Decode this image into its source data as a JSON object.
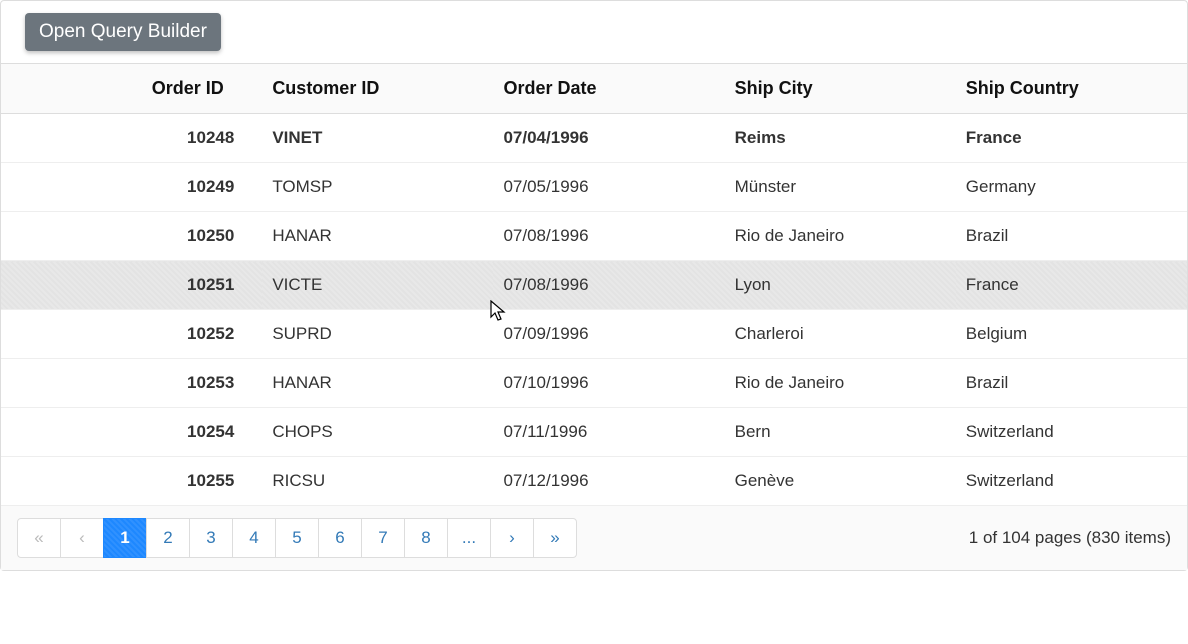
{
  "toolbar": {
    "open_qb_label": "Open Query Builder"
  },
  "columns": {
    "order_id": "Order ID",
    "customer_id": "Customer ID",
    "order_date": "Order Date",
    "ship_city": "Ship City",
    "ship_country": "Ship Country"
  },
  "rows": [
    {
      "order_id": "10248",
      "customer_id": "VINET",
      "order_date": "07/04/1996",
      "ship_city": "Reims",
      "ship_country": "France",
      "selected": true
    },
    {
      "order_id": "10249",
      "customer_id": "TOMSP",
      "order_date": "07/05/1996",
      "ship_city": "Münster",
      "ship_country": "Germany"
    },
    {
      "order_id": "10250",
      "customer_id": "HANAR",
      "order_date": "07/08/1996",
      "ship_city": "Rio de Janeiro",
      "ship_country": "Brazil"
    },
    {
      "order_id": "10251",
      "customer_id": "VICTE",
      "order_date": "07/08/1996",
      "ship_city": "Lyon",
      "ship_country": "France",
      "hovered": true
    },
    {
      "order_id": "10252",
      "customer_id": "SUPRD",
      "order_date": "07/09/1996",
      "ship_city": "Charleroi",
      "ship_country": "Belgium"
    },
    {
      "order_id": "10253",
      "customer_id": "HANAR",
      "order_date": "07/10/1996",
      "ship_city": "Rio de Janeiro",
      "ship_country": "Brazil"
    },
    {
      "order_id": "10254",
      "customer_id": "CHOPS",
      "order_date": "07/11/1996",
      "ship_city": "Bern",
      "ship_country": "Switzerland"
    },
    {
      "order_id": "10255",
      "customer_id": "RICSU",
      "order_date": "07/12/1996",
      "ship_city": "Genève",
      "ship_country": "Switzerland"
    }
  ],
  "pager": {
    "first_glyph": "«",
    "prev_glyph": "‹",
    "next_glyph": "›",
    "last_glyph": "»",
    "ellipsis": "...",
    "pages": [
      "1",
      "2",
      "3",
      "4",
      "5",
      "6",
      "7",
      "8"
    ],
    "active": "1"
  },
  "summary": "1 of 104 pages (830 items)"
}
